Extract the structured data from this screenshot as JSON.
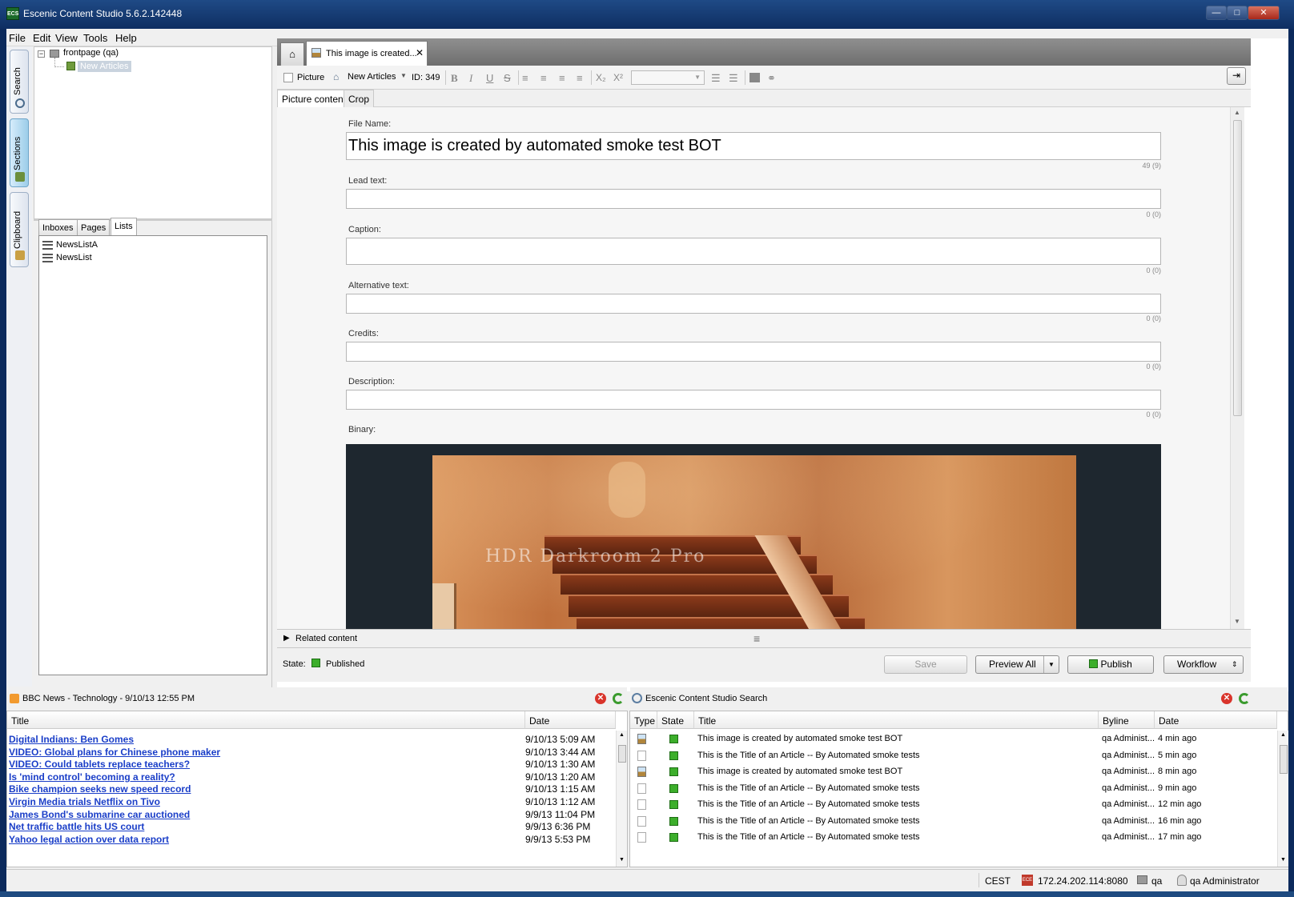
{
  "window": {
    "title": "Escenic Content Studio 5.6.2.142448",
    "app_icon": "ECS",
    "minimize": "—",
    "maximize": "□",
    "close": "✕"
  },
  "menu": [
    "File",
    "Edit",
    "View",
    "Tools",
    "Help"
  ],
  "vtabs": [
    "Search",
    "Sections",
    "Clipboard"
  ],
  "tree": {
    "root": "frontpage (qa)",
    "child": "New Articles"
  },
  "left_tabs": [
    "Inboxes",
    "Pages",
    "Lists"
  ],
  "lists": [
    "NewsListA",
    "NewsList"
  ],
  "editor": {
    "doc_tab": "This image is created...",
    "doc_close": "✕",
    "toolbar": {
      "type_label": "Picture",
      "section": "New Articles",
      "id": "ID: 349"
    },
    "subtabs": [
      "Picture content",
      "Crop"
    ],
    "fields": {
      "file_name_label": "File Name:",
      "file_name_value": "This image is created by automated smoke test BOT",
      "file_name_count": "49 (9)",
      "lead_label": "Lead text:",
      "lead_count": "0 (0)",
      "caption_label": "Caption:",
      "caption_count": "0 (0)",
      "alt_label": "Alternative text:",
      "alt_count": "0 (0)",
      "credits_label": "Credits:",
      "credits_count": "0 (0)",
      "description_label": "Description:",
      "description_count": "0 (0)",
      "binary_label": "Binary:"
    },
    "watermark": "HDR Darkroom 2 Pro",
    "related": "Related content",
    "state_label": "State:",
    "state_value": "Published",
    "buttons": {
      "save": "Save",
      "preview": "Preview All",
      "publish": "Publish",
      "workflow": "Workflow"
    }
  },
  "rss": {
    "title": "BBC News - Technology - 9/10/13 12:55 PM",
    "columns": [
      "Title",
      "Date"
    ],
    "rows": [
      {
        "title": "Digital Indians: Ben Gomes",
        "date": "9/10/13 5:09 AM"
      },
      {
        "title": "VIDEO: Global plans for Chinese phone maker",
        "date": "9/10/13 3:44 AM"
      },
      {
        "title": "VIDEO: Could tablets replace teachers?",
        "date": "9/10/13 1:30 AM"
      },
      {
        "title": "Is 'mind control' becoming a reality?",
        "date": "9/10/13 1:20 AM"
      },
      {
        "title": "Bike champion seeks new speed record",
        "date": "9/10/13 1:15 AM"
      },
      {
        "title": "Virgin Media trials Netflix on Tivo",
        "date": "9/10/13 1:12 AM"
      },
      {
        "title": "James Bond's submarine car auctioned",
        "date": "9/9/13 11:04 PM"
      },
      {
        "title": "Net traffic battle hits US court",
        "date": "9/9/13 6:36 PM"
      },
      {
        "title": "Yahoo legal action over data report",
        "date": "9/9/13 5:53 PM"
      }
    ]
  },
  "search": {
    "title": "Escenic Content Studio Search",
    "columns": [
      "Type",
      "State",
      "Title",
      "Byline",
      "Date"
    ],
    "rows": [
      {
        "type": "picture",
        "title": "This image is created by automated smoke test BOT",
        "byline": "qa Administ...",
        "date": "4 min ago"
      },
      {
        "type": "article",
        "title": "This is the Title of an Article -- By Automated smoke tests",
        "byline": "qa Administ...",
        "date": "5 min ago"
      },
      {
        "type": "picture",
        "title": "This image is created by automated smoke test BOT",
        "byline": "qa Administ...",
        "date": "8 min ago"
      },
      {
        "type": "article",
        "title": "This is the Title of an Article -- By Automated smoke tests",
        "byline": "qa Administ...",
        "date": "9 min ago"
      },
      {
        "type": "article",
        "title": "This is the Title of an Article -- By Automated smoke tests",
        "byline": "qa Administ...",
        "date": "12 min ago"
      },
      {
        "type": "article",
        "title": "This is the Title of an Article -- By Automated smoke tests",
        "byline": "qa Administ...",
        "date": "16 min ago"
      },
      {
        "type": "article",
        "title": "This is the Title of an Article -- By Automated smoke tests",
        "byline": "qa Administ...",
        "date": "17 min ago"
      }
    ]
  },
  "statusbar": {
    "timezone": "CEST",
    "server": "172.24.202.114:8080",
    "publication": "qa",
    "user": "qa Administrator"
  },
  "colors": {
    "published": "#3cae2b",
    "link": "#1a3ec8",
    "titlebar": "#0e2e62"
  }
}
